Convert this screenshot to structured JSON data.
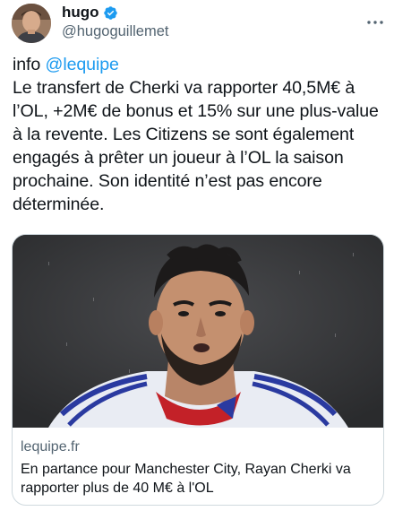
{
  "author": {
    "display_name": "hugo",
    "handle": "@hugoguillemet",
    "verified_icon": "verified-badge-icon",
    "avatar_icon": "profile-photo"
  },
  "more_menu_icon": "more-horizontal-icon",
  "tweet": {
    "prefix": "info ",
    "mention": "@lequipe",
    "body": "Le transfert de Cherki va rapporter 40,5M€ à l’OL, +2M€ de bonus et 15% sur une plus-value à la revente. Les Citizens se sont également engagés à prêter un joueur à l’OL la saison prochaine. Son identité n’est pas encore déterminée."
  },
  "card": {
    "image_alt": "footballer-photo",
    "domain": "lequipe.fr",
    "title": "En partance pour Manchester City, Rayan Cherki va rapporter plus de 40 M€ à l'OL"
  },
  "colors": {
    "link": "#1d9bf0",
    "secondary_text": "#536471",
    "border": "#cfd9de",
    "verified": "#1d9bf0"
  }
}
